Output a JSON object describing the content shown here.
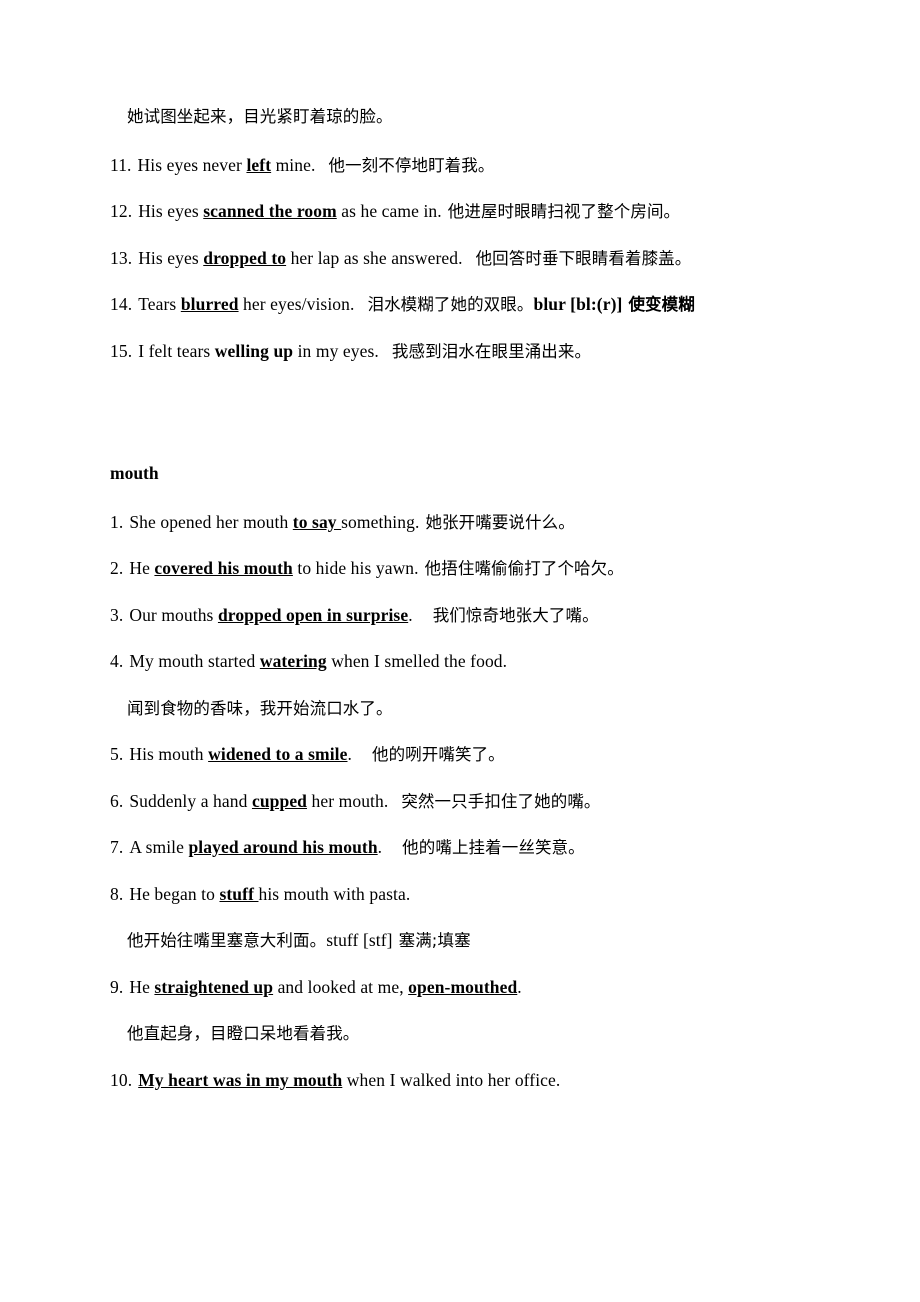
{
  "document": {
    "page_background": "#ffffff",
    "text_color": "#000000"
  },
  "eyes_section": {
    "continuation_line": "她试图坐起来，目光紧盯着琼的脸。",
    "items": [
      {
        "number": "11.",
        "en_before": "His eyes never ",
        "en_highlight": "left",
        "en_after": " mine.",
        "cn": "他一刻不停地盯着我。"
      },
      {
        "number": "12.",
        "en_before": "His eyes ",
        "en_highlight": "scanned the room",
        "en_after": " as he came in.",
        "cn": "他进屋时眼睛扫视了整个房间。"
      },
      {
        "number": "13.",
        "en_before": "His eyes ",
        "en_highlight": "dropped to",
        "en_after": " her lap as she answered.",
        "cn": "他回答时垂下眼睛看着膝盖。"
      },
      {
        "number": "14.",
        "en_before": "Tears ",
        "en_highlight": "blurred",
        "en_after": " her eyes/vision.",
        "cn": "泪水模糊了她的双眼。",
        "gloss_word": "blur [bl:(r)]",
        "gloss_def": "使变模糊"
      },
      {
        "number": "15.",
        "en_before": "I felt tears ",
        "en_highlight": "welling up",
        "en_after": " in my eyes.",
        "cn": "我感到泪水在眼里涌出来。"
      }
    ]
  },
  "mouth_section": {
    "heading": "mouth",
    "items": [
      {
        "number": "1.",
        "en_before": "She opened her mouth ",
        "en_highlight": "to say ",
        "en_after": "something.",
        "cn": "她张开嘴要说什么。"
      },
      {
        "number": "2.",
        "en_before": "He ",
        "en_highlight": "covered his mouth",
        "en_after": " to hide his yawn.",
        "cn": "他捂住嘴偷偷打了个哈欠。"
      },
      {
        "number": "3.",
        "en_before": "Our mouths ",
        "en_highlight": "dropped open in surprise",
        "en_after": ".",
        "cn": "我们惊奇地张大了嘴。"
      },
      {
        "number": "4.",
        "en_before": "My mouth started ",
        "en_highlight": "watering",
        "en_after": " when I smelled the food.",
        "cn_own_line": "闻到食物的香味，我开始流口水了。"
      },
      {
        "number": "5.",
        "en_before": "His mouth ",
        "en_highlight": "widened to a smile",
        "en_after": ".",
        "cn": "他的咧开嘴笑了。"
      },
      {
        "number": "6.",
        "en_before": "Suddenly a hand ",
        "en_highlight": "cupped",
        "en_after": " her mouth.",
        "cn": "突然一只手扣住了她的嘴。"
      },
      {
        "number": "7.",
        "en_before": "A smile ",
        "en_highlight": "played around his mouth",
        "en_after": ".",
        "cn": "他的嘴上挂着一丝笑意。"
      },
      {
        "number": "8.",
        "en_before": "He began to ",
        "en_highlight": "stuff ",
        "en_after": "his mouth with pasta.",
        "cn_own_line": "他开始往嘴里塞意大利面。",
        "gloss_word": "stuff [stf]",
        "gloss_def": "塞满;填塞"
      },
      {
        "number": "9.",
        "en_before": "He ",
        "en_highlight": "straightened up",
        "en_mid": " and looked at me, ",
        "en_highlight2": "open-mouthed",
        "en_after": ".",
        "cn_own_line": "他直起身，目瞪口呆地看着我。"
      },
      {
        "number": "10.",
        "en_before": "",
        "en_highlight": "My heart was in my mouth",
        "en_after": " when I walked into her office."
      }
    ]
  }
}
